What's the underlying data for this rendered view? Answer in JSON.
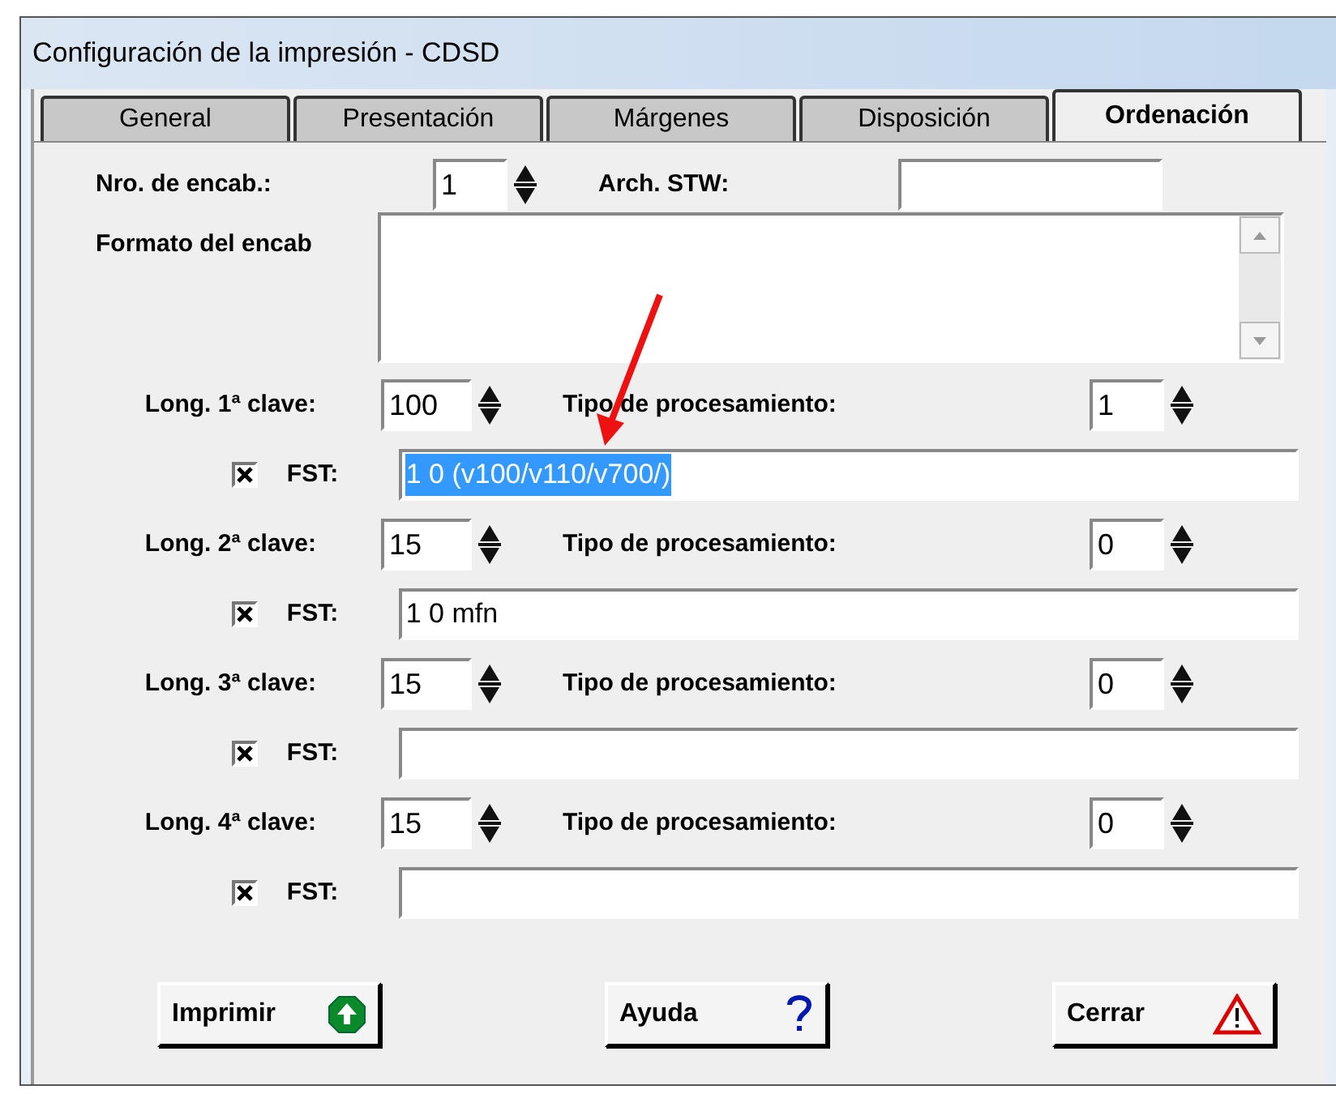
{
  "window": {
    "title": "Configuración de la impresión - CDSD"
  },
  "tabs": [
    {
      "label": "General",
      "selected": false
    },
    {
      "label": "Presentación",
      "selected": false
    },
    {
      "label": "Márgenes",
      "selected": false
    },
    {
      "label": "Disposición",
      "selected": false
    },
    {
      "label": "Ordenación",
      "selected": true
    }
  ],
  "header": {
    "count_label": "Nro. de encab.:",
    "count_value": "1",
    "stw_label": "Arch.  STW:",
    "format_label": "Formato del encab"
  },
  "keys": [
    {
      "length_label": "Long. 1ª clave:",
      "length_value": "100",
      "type_label": "Tipo de procesamiento:",
      "type_value": "1",
      "fst_checked": true,
      "fst_label": "FST:",
      "fst_value": "1 0 (v100/v110/v700/)",
      "fst_text_selected": true
    },
    {
      "length_label": "Long. 2ª clave:",
      "length_value": "15",
      "type_label": "Tipo de procesamiento:",
      "type_value": "0",
      "fst_checked": true,
      "fst_label": "FST:",
      "fst_value": "1 0 mfn",
      "fst_text_selected": false
    },
    {
      "length_label": "Long. 3ª clave:",
      "length_value": "15",
      "type_label": "Tipo de procesamiento:",
      "type_value": "0",
      "fst_checked": true,
      "fst_label": "FST:",
      "fst_text_selected": false
    },
    {
      "length_label": "Long. 4ª clave:",
      "length_value": "15",
      "type_label": "Tipo de procesamiento:",
      "type_value": "0",
      "fst_checked": true,
      "fst_label": "FST:",
      "fst_text_selected": false
    }
  ],
  "buttons": [
    {
      "kind": "print",
      "label": "Imprimir"
    },
    {
      "kind": "help",
      "label": "Ayuda"
    },
    {
      "kind": "close",
      "label": "Cerrar"
    }
  ]
}
